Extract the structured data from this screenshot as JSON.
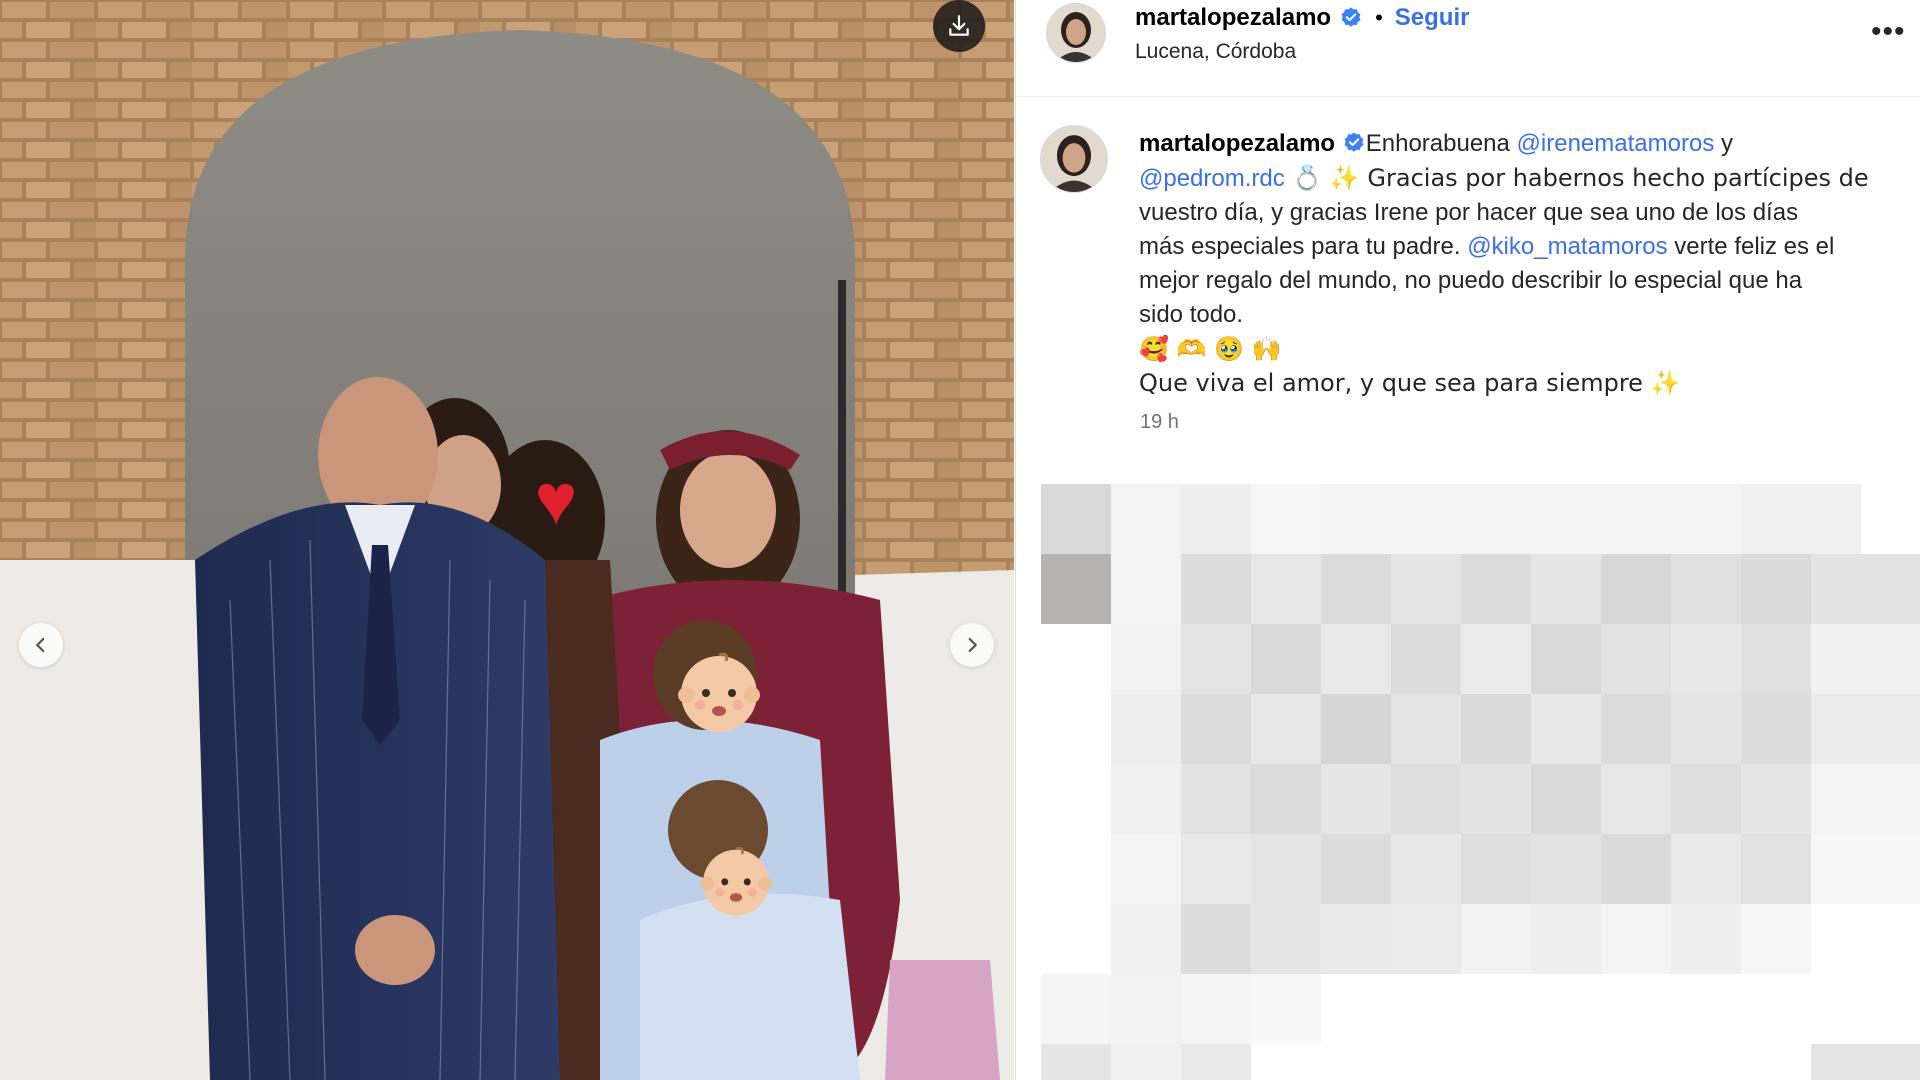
{
  "post": {
    "username": "martalopezalamo",
    "follow_label": "Seguir",
    "separator": "•",
    "location": "Lucena, Córdoba",
    "more_label": "•••"
  },
  "caption": {
    "username": "martalopezalamo",
    "line1_a": "Enhorabuena ",
    "mention_1": "@irenematamoros",
    "line1_b": " y",
    "mention_2": "@pedrom.rdc",
    "line2_b": " 💍 ✨ Gracias por habernos hecho partícipes de",
    "line3": "vuestro día, y gracias Irene por hacer que sea uno de los días",
    "line4_a": "más especiales para tu padre. ",
    "mention_3": "@kiko_matamoros",
    "line4_b": " verte feliz es el",
    "line5": "mejor regalo del mundo, no puedo describir lo especial que ha",
    "line6": "sido todo.",
    "line7": "🥰 🫶 🥹 🙌",
    "line8": "Que viva el amor, y que sea para siempre ✨"
  },
  "timestamp": "19 h",
  "icons": {
    "download": "download-icon",
    "prev": "chevron-left-icon",
    "next": "chevron-right-icon",
    "verified": "verified-badge-icon",
    "more": "more-options-icon"
  },
  "colors": {
    "link": "#3b6fe4",
    "verified": "#3b82f6",
    "secondary_text": "#737373"
  }
}
